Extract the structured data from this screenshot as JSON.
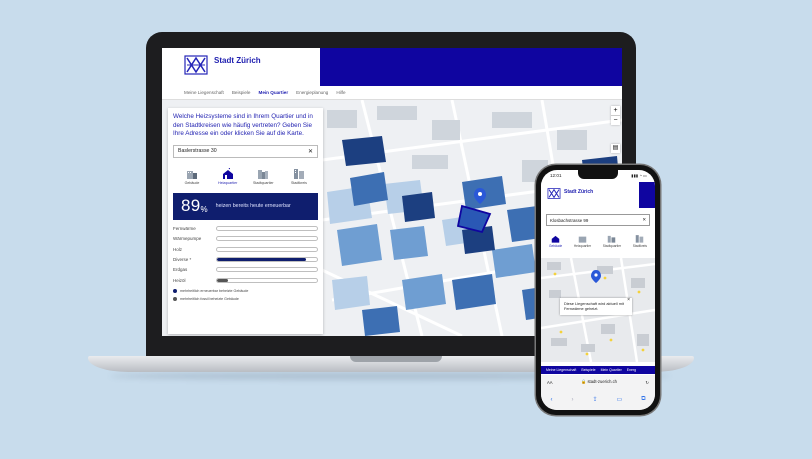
{
  "brand": {
    "name": "Stadt Zürich",
    "primary_color": "#0f05a0",
    "navy_color": "#0f1e6e"
  },
  "laptop": {
    "nav": [
      "Meine Liegenschaft",
      "Beispiele",
      "Mein Quartier",
      "Energieplanung",
      "Hilfe"
    ],
    "active_nav_index": 2,
    "panel": {
      "question": "Welche Heizsysteme sind in Ihrem Quartier und in den Stadtkreisen wie häufig vertreten? Geben Sie Ihre Adresse ein oder klicken Sie auf die Karte.",
      "search_value": "Baslerstrasse 30",
      "clear_icon": "close-icon",
      "tabs": [
        {
          "label": "Gebäude",
          "icon": "building-icon",
          "active": false
        },
        {
          "label": "Heizquartier",
          "icon": "house-heat-icon",
          "active": true
        },
        {
          "label": "Stadtquartier",
          "icon": "district-icon",
          "active": false
        },
        {
          "label": "Stadtkreis",
          "icon": "city-icon",
          "active": false
        }
      ],
      "stat_number": "89",
      "stat_unit": "%",
      "stat_text": "heizen bereits heute erneuerbar",
      "bars": [
        {
          "label": "Fernwärme",
          "value": 0,
          "color": "#0f1e6e"
        },
        {
          "label": "Wärmepumpe",
          "value": 0,
          "color": "#0f1e6e"
        },
        {
          "label": "Holz",
          "value": 0,
          "color": "#0f1e6e"
        },
        {
          "label": "Diverse *",
          "value": 0.89,
          "color": "#0f1e6e"
        },
        {
          "label": "Erdgas",
          "value": 0,
          "color": "#555555"
        },
        {
          "label": "Heizöl",
          "value": 0.11,
          "color": "#555555"
        }
      ],
      "legend": [
        {
          "text": "mehrheitlich erneuerbar beheizte Gebäude",
          "color": "#0f1e6e"
        },
        {
          "text": "mehrheitlich fossil beheizte Gebäude",
          "color": "#555555"
        }
      ]
    },
    "map_controls": {
      "zoom_in": "+",
      "zoom_out": "−",
      "layers_icon": "layers-icon"
    }
  },
  "phone": {
    "status_time": "12:01",
    "status_icons": "▮▮▮ ◔ ▭",
    "search_value": "Klosbachstrasse 99",
    "clear_icon": "close-icon",
    "tabs": [
      {
        "label": "Gebäude",
        "active": true
      },
      {
        "label": "Heizquartier",
        "active": false
      },
      {
        "label": "Stadtquartier",
        "active": false
      },
      {
        "label": "Stadtkreis",
        "active": false
      }
    ],
    "popup_text": "Diese Liegenschaft wird aktuell mit Fernwärme geheizt.",
    "popup_close": "×",
    "nav": [
      "Meine Liegenschaft",
      "Beispiele",
      "Mein Quartier",
      "Energ"
    ],
    "url_aa": "AA",
    "url": "🔒 stadt-zuerich.ch",
    "reload_icon": "↻",
    "toolbar": {
      "back": "‹",
      "forward": "›",
      "share": "⇪",
      "bookmarks": "▭",
      "tabs": "⧉"
    }
  }
}
